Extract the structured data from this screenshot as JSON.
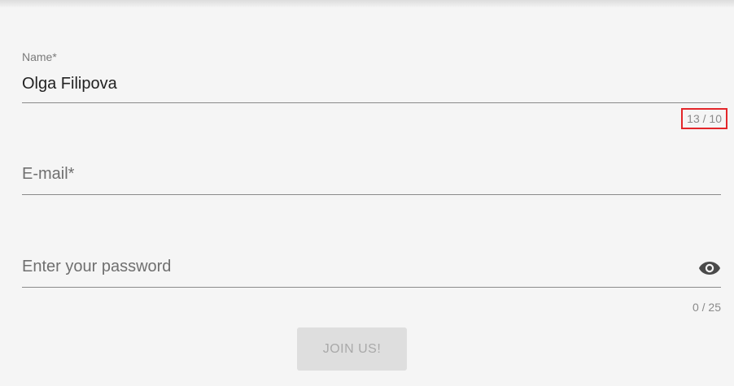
{
  "form": {
    "name_field": {
      "label": "Name*",
      "value": "Olga Filipova",
      "counter": "13 / 10"
    },
    "email_field": {
      "label": "E-mail*",
      "value": ""
    },
    "password_field": {
      "label": "Enter your password",
      "value": "",
      "counter": "0 / 25",
      "toggle_icon": "eye-icon"
    },
    "submit_button": {
      "label": "JOIN US!"
    }
  },
  "colors": {
    "background": "#f5f5f5",
    "error_highlight": "#e3262a",
    "button_disabled_bg": "#dedede",
    "button_disabled_text": "#a9a9a9"
  }
}
